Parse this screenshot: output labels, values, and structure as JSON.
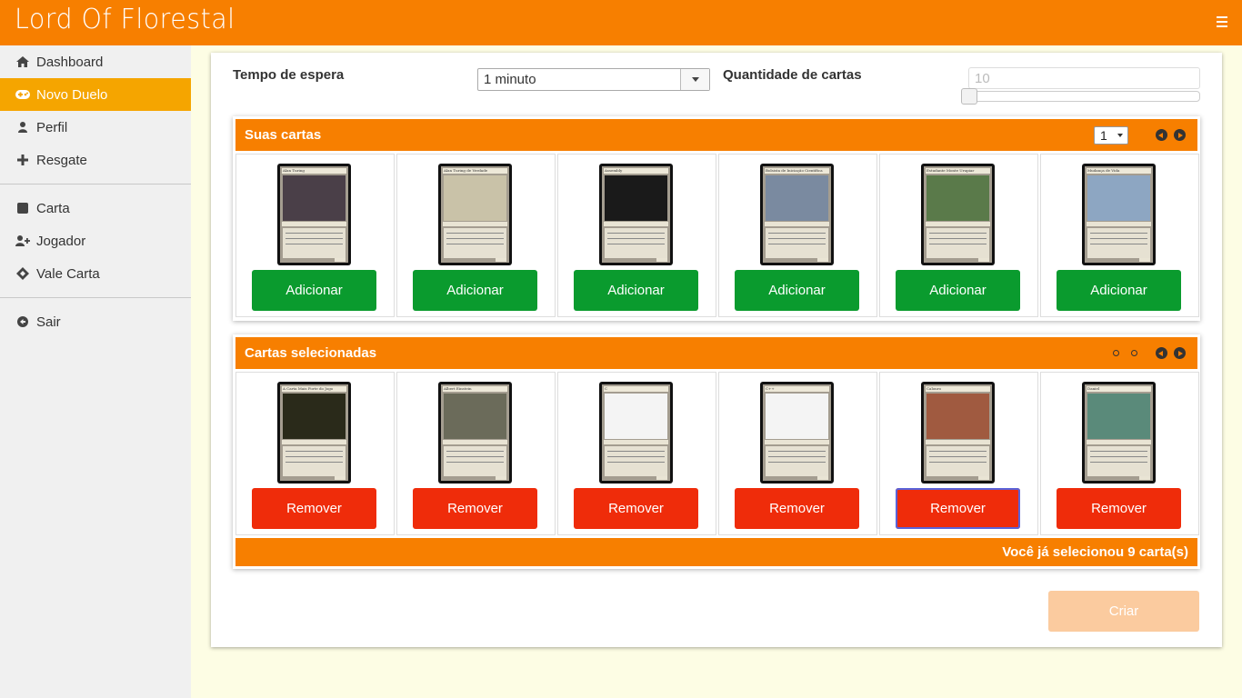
{
  "app": {
    "title": "Lord Of Florestal"
  },
  "sidebar": {
    "items": [
      {
        "label": "Dashboard",
        "icon": "home-icon"
      },
      {
        "label": "Novo Duelo",
        "icon": "gamepad-icon",
        "active": true
      },
      {
        "label": "Perfil",
        "icon": "user-icon"
      },
      {
        "label": "Resgate",
        "icon": "plus-icon"
      },
      {
        "label": "Carta",
        "icon": "square-icon"
      },
      {
        "label": "Jogador",
        "icon": "user-plus-icon"
      },
      {
        "label": "Vale Carta",
        "icon": "ticket-icon"
      },
      {
        "label": "Sair",
        "icon": "arrow-circle-left-icon"
      }
    ]
  },
  "form": {
    "wait_label": "Tempo de espera",
    "wait_value": "1 minuto",
    "qty_label": "Quantidade de cartas",
    "qty_placeholder": "10",
    "qty_slider_fraction": 0
  },
  "your_cards": {
    "title": "Suas cartas",
    "page": "1",
    "button_label": "Adicionar",
    "cards": [
      {
        "name": "Alan Turing",
        "art_color": "#4a3f48"
      },
      {
        "name": "Alan Turing de Verdade",
        "art_color": "#c9c2a8"
      },
      {
        "name": "Assembly",
        "art_color": "#1a1a1a"
      },
      {
        "name": "Bolsista de Iniciação Científica",
        "art_color": "#7a8aa0"
      },
      {
        "name": "Estudante Monte Urupiar",
        "art_color": "#5a7a4a"
      },
      {
        "name": "Mudança de Vida",
        "art_color": "#8da6c2"
      }
    ]
  },
  "selected_cards": {
    "title": "Cartas selecionadas",
    "button_label": "Remover",
    "cards": [
      {
        "name": "A Carta Mais Forte do Jogo",
        "art_color": "#2a2a1a"
      },
      {
        "name": "Albert Einstein",
        "art_color": "#6b6b5a"
      },
      {
        "name": "C",
        "art_color": "#f4f4f4"
      },
      {
        "name": "C++",
        "art_color": "#f4f4f4"
      },
      {
        "name": "Calouro",
        "art_color": "#a05a40"
      },
      {
        "name": "Daniel",
        "art_color": "#5a8a7a"
      }
    ],
    "summary": "Você já selecionou 9 carta(s)"
  },
  "actions": {
    "create_label": "Criar"
  }
}
